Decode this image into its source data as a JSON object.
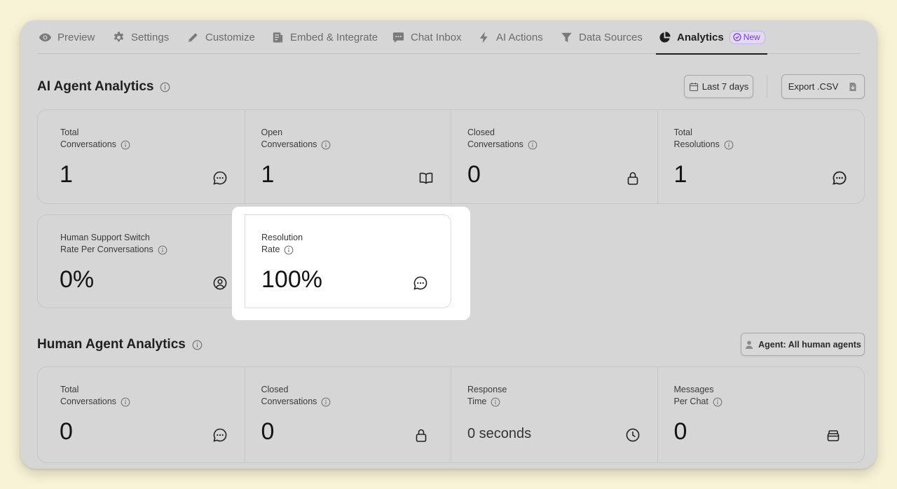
{
  "tabs": [
    {
      "label": "Preview",
      "icon": "eye-icon"
    },
    {
      "label": "Settings",
      "icon": "gear-icon"
    },
    {
      "label": "Customize",
      "icon": "pencil-icon"
    },
    {
      "label": "Embed & Integrate",
      "icon": "document-icon"
    },
    {
      "label": "Chat Inbox",
      "icon": "chat-bubble-icon"
    },
    {
      "label": "AI Actions",
      "icon": "lightning-icon"
    },
    {
      "label": "Data Sources",
      "icon": "funnel-icon"
    },
    {
      "label": "Analytics",
      "icon": "pie-chart-icon",
      "active": true,
      "badge": "New"
    }
  ],
  "ai_section": {
    "title": "AI Agent Analytics",
    "date_range_label": "Last 7 days",
    "export_label": "Export .CSV",
    "cards": [
      {
        "label_line1": "Total",
        "label_line2": "Conversations",
        "value": "1",
        "icon": "chat-dots-icon"
      },
      {
        "label_line1": "Open",
        "label_line2": "Conversations",
        "value": "1",
        "icon": "book-open-icon"
      },
      {
        "label_line1": "Closed",
        "label_line2": "Conversations",
        "value": "0",
        "icon": "lock-icon"
      },
      {
        "label_line1": "Total",
        "label_line2": "Resolutions",
        "value": "1",
        "icon": "chat-dots-icon"
      },
      {
        "label_line1": "Human Support Switch",
        "label_line2": "Rate Per Conversations",
        "value": "0%",
        "icon": "user-circle-icon"
      },
      {
        "label_line1": "Resolution",
        "label_line2": "Rate",
        "value": "100%",
        "icon": "chat-dots-icon"
      }
    ]
  },
  "human_section": {
    "title": "Human Agent Analytics",
    "agent_filter_label": "Agent: All human agents",
    "cards": [
      {
        "label_line1": "Total",
        "label_line2": "Conversations",
        "value": "0",
        "icon": "chat-dots-icon"
      },
      {
        "label_line1": "Closed",
        "label_line2": "Conversations",
        "value": "0",
        "icon": "lock-icon"
      },
      {
        "label_line1": "Response",
        "label_line2": "Time",
        "value": "0 seconds",
        "icon": "clock-icon"
      },
      {
        "label_line1": "Messages",
        "label_line2": "Per Chat",
        "value": "0",
        "icon": "inbox-tray-icon"
      }
    ]
  },
  "colors": {
    "page_background": "#f8f2d6",
    "window_background": "#d6d6d6",
    "badge_accent": "#7a3fd0",
    "highlight": "#ffffff"
  }
}
